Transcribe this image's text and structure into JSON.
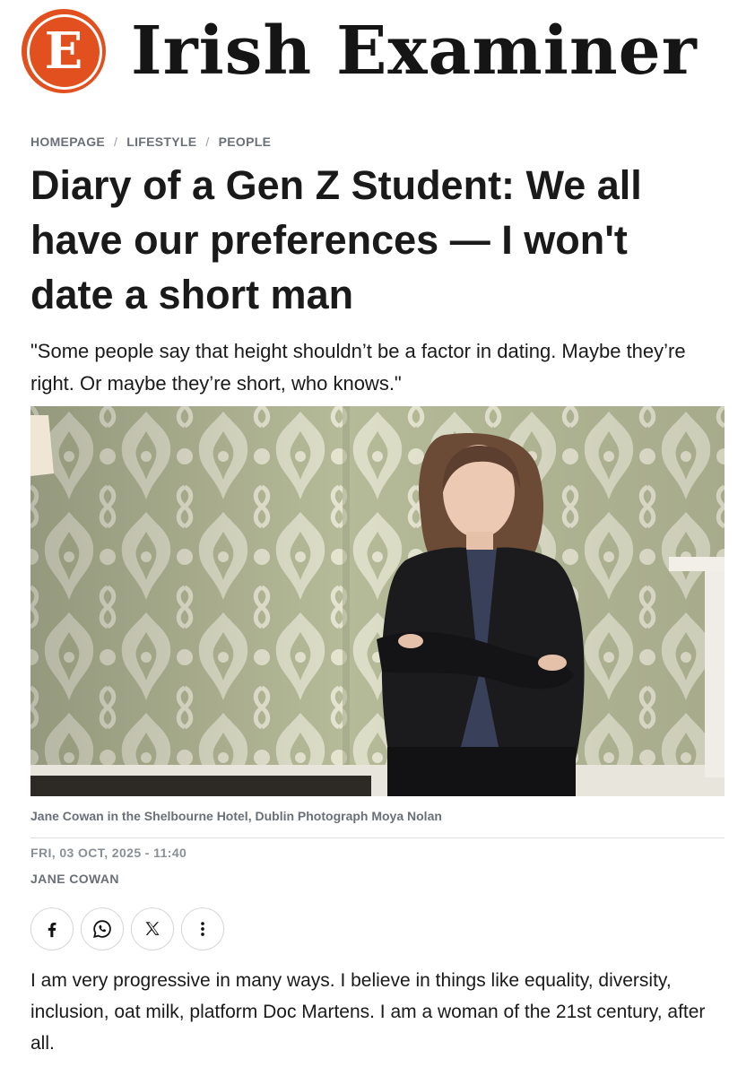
{
  "masthead": {
    "logo_glyph": "E",
    "title": "Irish  Examiner",
    "brand_color": "#e2501f"
  },
  "breadcrumb": {
    "items": [
      "HOMEPAGE",
      "LIFESTYLE",
      "PEOPLE"
    ],
    "separator": "/"
  },
  "article": {
    "headline": "Diary of a Gen Z Student: We all have our preferences — I won't date a short man",
    "standfirst": "\"Some people say that height shouldn’t be a factor in dating. Maybe they’re right. Or maybe they’re short, who knows.\"",
    "photo_caption": "Jane Cowan in the Shelbourne Hotel, Dublin Photograph Moya Nolan",
    "date": "FRI, 03 OCT, 2025 - 11:40",
    "author": "JANE COWAN",
    "first_paragraph": "I am very progressive in many ways. I believe in things like equality, diversity, inclusion, oat milk, platform Doc Martens. I am a woman of the 21st century, after all."
  },
  "share_buttons": [
    {
      "icon": "facebook-icon"
    },
    {
      "icon": "whatsapp-icon"
    },
    {
      "icon": "x-icon"
    },
    {
      "icon": "more-vertical-icon"
    }
  ]
}
